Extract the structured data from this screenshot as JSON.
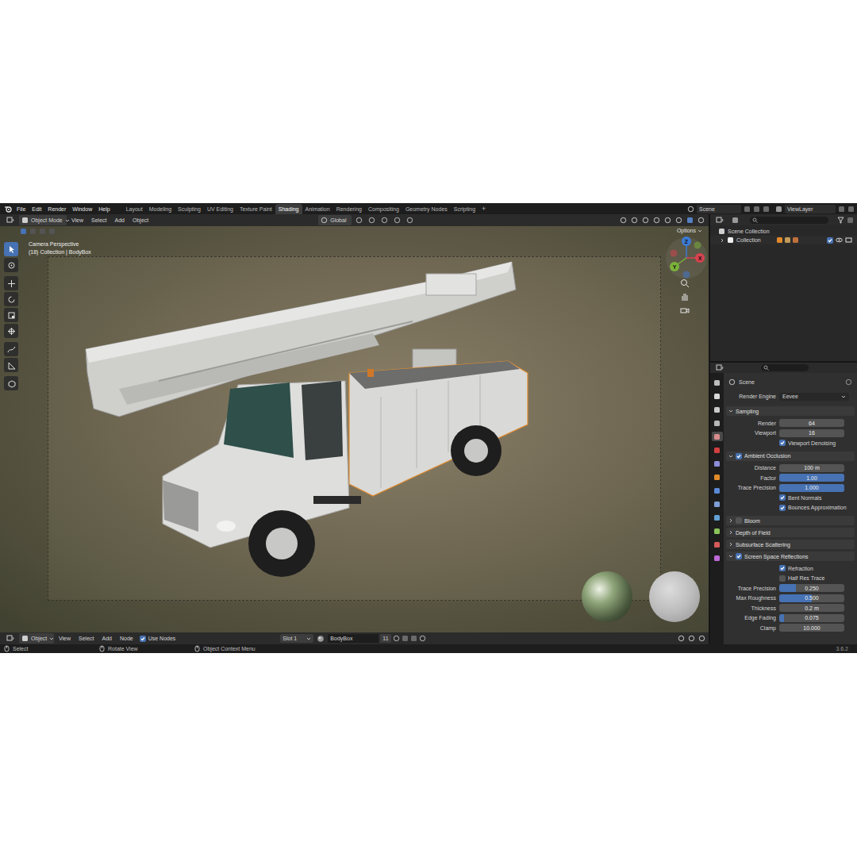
{
  "menubar": {
    "menus": [
      "File",
      "Edit",
      "Render",
      "Window",
      "Help"
    ],
    "workspaces": [
      {
        "label": "Layout",
        "selected": false
      },
      {
        "label": "Modeling",
        "selected": false
      },
      {
        "label": "Sculpting",
        "selected": false
      },
      {
        "label": "UV Editing",
        "selected": false
      },
      {
        "label": "Texture Paint",
        "selected": false
      },
      {
        "label": "Shading",
        "selected": true
      },
      {
        "label": "Animation",
        "selected": false
      },
      {
        "label": "Rendering",
        "selected": false
      },
      {
        "label": "Compositing",
        "selected": false
      },
      {
        "label": "Geometry Nodes",
        "selected": false
      },
      {
        "label": "Scripting",
        "selected": false
      }
    ],
    "add_workspace": "+",
    "scene": "Scene",
    "view_layer": "ViewLayer"
  },
  "viewport": {
    "mode": "Object Mode",
    "menus": [
      "View",
      "Select",
      "Add",
      "Object"
    ],
    "orientation": "Global",
    "options": "Options",
    "overlay_lines": [
      "Camera Perspective",
      "(18) Collection | BodyBox"
    ],
    "tools": [
      {
        "selected": true
      },
      {
        "selected": false
      },
      {
        "selected": false
      },
      {
        "selected": false
      },
      {
        "selected": false
      },
      {
        "selected": false
      },
      {
        "selected": false
      },
      {
        "selected": false
      },
      {
        "selected": false
      }
    ],
    "gizmo": [
      {
        "label": "Z",
        "color": "#3d7ad6"
      },
      {
        "label": "Y",
        "color": "#7bb33a"
      },
      {
        "label": "X",
        "color": "#d8424f"
      }
    ]
  },
  "shader_header": {
    "editor": "Object",
    "menus": [
      "View",
      "Select",
      "Add",
      "Node"
    ],
    "use_nodes": {
      "label": "Use Nodes",
      "checked": true
    },
    "slot": "Slot 1",
    "material": "BodyBox",
    "users": "11"
  },
  "outliner": {
    "rows": [
      {
        "label": "Scene Collection",
        "kind": "scene"
      },
      {
        "label": "Collection",
        "kind": "collection",
        "expanded": false,
        "included": true
      }
    ]
  },
  "properties": {
    "context": "Scene",
    "tabs": [
      {
        "selected": false
      },
      {
        "selected": false
      },
      {
        "selected": false
      },
      {
        "selected": false
      },
      {
        "selected": true
      },
      {
        "selected": false
      },
      {
        "selected": false
      },
      {
        "selected": false
      },
      {
        "selected": false
      },
      {
        "selected": false
      },
      {
        "selected": false
      },
      {
        "selected": false
      },
      {
        "selected": false
      },
      {
        "selected": false
      }
    ],
    "render_engine": {
      "label": "Render Engine",
      "value": "Eevee"
    },
    "panels": [
      {
        "title": "Sampling",
        "expanded": true,
        "rows": [
          {
            "kind": "number",
            "label": "Render",
            "value": "64"
          },
          {
            "kind": "number",
            "label": "Viewport",
            "value": "16"
          },
          {
            "kind": "check",
            "label": "Viewport Denoising",
            "checked": true
          }
        ]
      },
      {
        "title": "Ambient Occlusion",
        "expanded": true,
        "checked": true,
        "rows": [
          {
            "kind": "number",
            "label": "Distance",
            "value": "100 m"
          },
          {
            "kind": "slider",
            "label": "Factor",
            "value": "1.00",
            "level": 1
          },
          {
            "kind": "slider",
            "label": "Trace Precision",
            "value": "1.000",
            "level": 1
          },
          {
            "kind": "check",
            "label": "Bent Normals",
            "checked": true
          },
          {
            "kind": "check",
            "label": "Bounces Approximation",
            "checked": true
          }
        ]
      },
      {
        "title": "Bloom",
        "expanded": false,
        "checked": false
      },
      {
        "title": "Depth of Field",
        "expanded": false
      },
      {
        "title": "Subsurface Scattering",
        "expanded": false
      },
      {
        "title": "Screen Space Reflections",
        "expanded": true,
        "checked": true,
        "rows": [
          {
            "kind": "check",
            "label": "Refraction",
            "checked": true
          },
          {
            "kind": "check",
            "label": "Half Res Trace",
            "checked": false
          },
          {
            "kind": "slider",
            "label": "Trace Precision",
            "value": "0.250",
            "level": 0.25
          },
          {
            "kind": "slider",
            "label": "Max Roughness",
            "value": "0.500",
            "level": 0.5
          },
          {
            "kind": "number",
            "label": "Thickness",
            "value": "0.2 m"
          },
          {
            "kind": "slider",
            "label": "Edge Fading",
            "value": "0.075",
            "level": 0.075
          },
          {
            "kind": "number",
            "label": "Clamp",
            "value": "10.000"
          }
        ]
      }
    ]
  },
  "status_bar": {
    "items": [
      "Select",
      "Rotate View",
      "Object Context Menu"
    ],
    "version": "3.6.2"
  }
}
